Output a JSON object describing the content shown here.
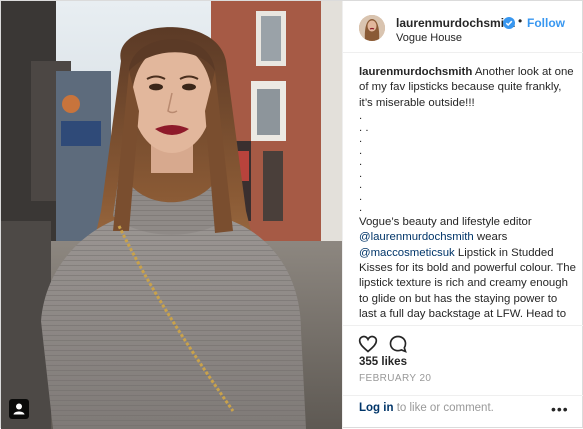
{
  "post": {
    "username": "laurenmurdochsmith",
    "follow_label": "Follow",
    "separator": "•",
    "location": "Vogue House"
  },
  "caption": {
    "username": "laurenmurdochsmith",
    "first_text": " Another look at one of my fav lipsticks because quite frankly, it’s miserable outside!!!",
    "dots": [
      ".",
      ". .",
      ".",
      ".",
      ".",
      ".",
      ".",
      ".",
      "."
    ],
    "body_part1": "Vogue’s beauty and lifestyle editor ",
    "mention1": "@laurenmurdochsmith",
    "body_part2": " wears ",
    "mention2": "@maccosmeticsuk",
    "body_part3": " Lipstick in Studded Kisses for its bold and powerful colour. The lipstick texture is rich and creamy enough to glide on but has the staying power to last a full day backstage at LFW. Head to your nearest MAC store to find"
  },
  "engagement": {
    "likes": "355 likes",
    "date": "FEBRUARY 20"
  },
  "comment_bar": {
    "login_link": "Log in",
    "login_rest": " to like or comment.",
    "more": "•••"
  },
  "icons": {
    "verified": "verified-badge-icon",
    "heart": "heart-icon",
    "comment": "comment-icon",
    "tag": "user-tag-icon",
    "more": "more-options-icon"
  },
  "colors": {
    "link_blue": "#3897f0",
    "mention_navy": "#003569",
    "muted_gray": "#999999",
    "lip_red": "#8e1a2a"
  }
}
